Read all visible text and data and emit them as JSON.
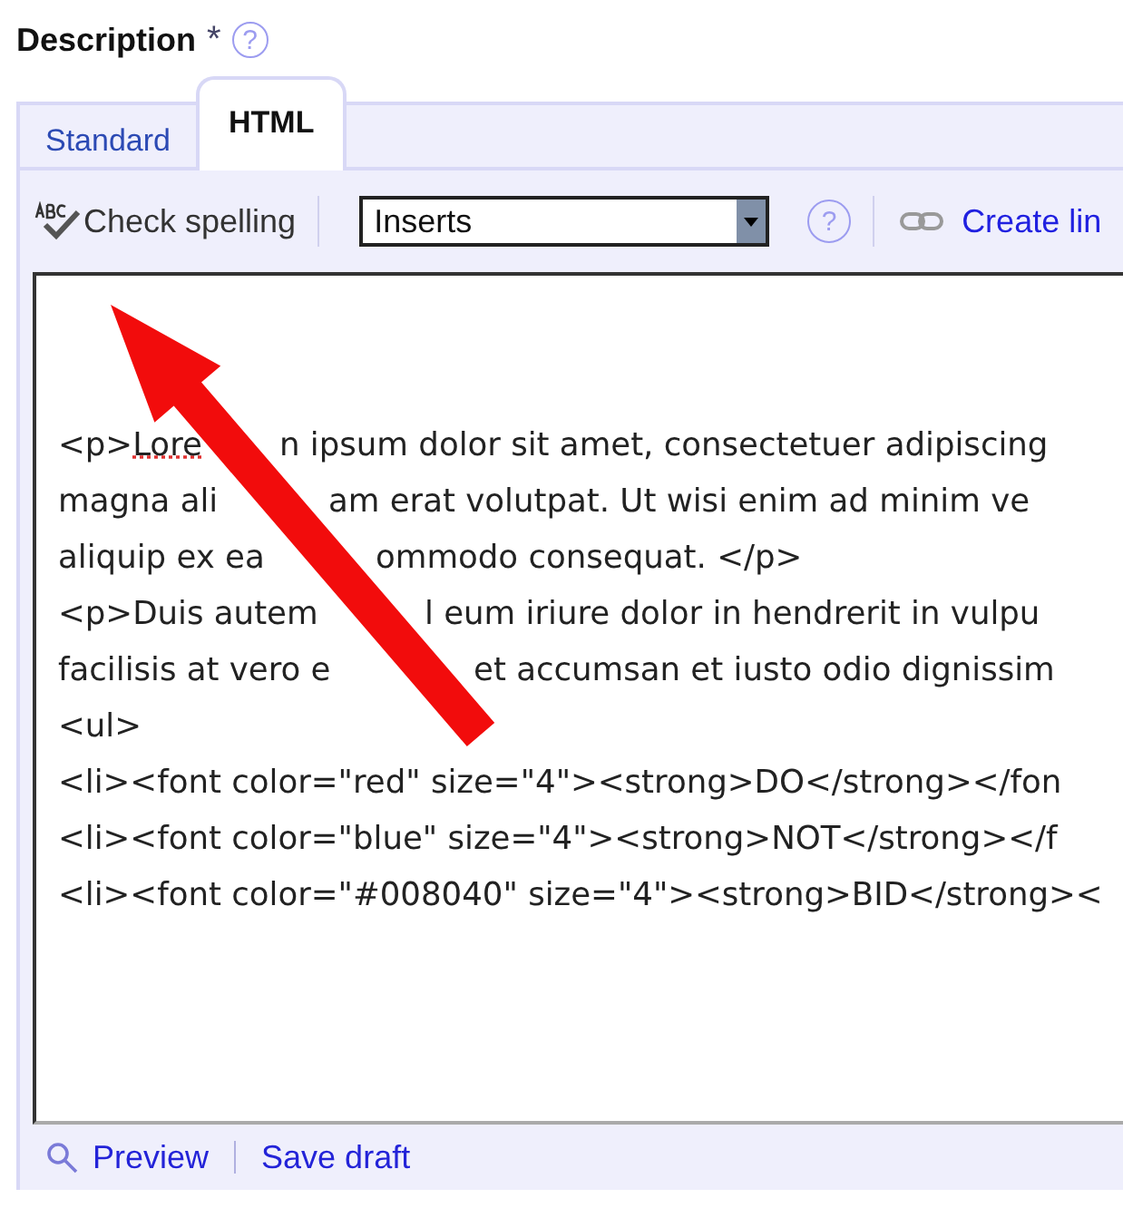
{
  "field": {
    "label": "Description",
    "required_mark": "*",
    "help": "?"
  },
  "tabs": [
    {
      "label": "Standard",
      "selected": false
    },
    {
      "label": "HTML",
      "selected": true
    }
  ],
  "toolbar": {
    "spellcheck": "Check spelling",
    "inserts": {
      "value": "Inserts"
    },
    "help": "?",
    "create_link": "Create lin"
  },
  "editor": {
    "lines": [
      {
        "before": [
          {
            "text": "<p>",
            "misspelled": false
          },
          {
            "text": "Lore",
            "misspelled": true
          }
        ],
        "after": "n ipsum dolor sit amet, consectetuer adipiscing"
      },
      {
        "before": [
          {
            "text": "magna ali",
            "misspelled": false
          }
        ],
        "after": "am erat volutpat. Ut wisi enim ad minim ve"
      },
      {
        "before": [
          {
            "text": "aliquip ex ea",
            "misspelled": false
          }
        ],
        "after": "ommodo consequat. </p>"
      },
      {
        "before": [
          {
            "text": "<p>Duis autem",
            "misspelled": false
          }
        ],
        "after": "l eum iriure dolor in hendrerit in vulpu"
      },
      {
        "before": [
          {
            "text": "facilisis at vero e",
            "misspelled": false
          }
        ],
        "after": "et accumsan et iusto odio dignissim"
      },
      {
        "before": [
          {
            "text": "<ul>",
            "misspelled": false
          }
        ]
      },
      {
        "before": [
          {
            "text": "<li><font color=\"red\" size=\"4\"><strong>DO</strong></fon",
            "misspelled": false
          }
        ]
      },
      {
        "before": [
          {
            "text": "<li><font color=\"blue\" size=\"4\"><strong>NOT</strong></f",
            "misspelled": false
          }
        ]
      },
      {
        "before": [
          {
            "text": "<li><font color=\"#008040\" size=\"4\"><strong>BID</strong><",
            "misspelled": false
          }
        ]
      }
    ],
    "overlay": {
      "kind": "arrow"
    }
  },
  "footer": {
    "links": [
      "Preview",
      "Save draft"
    ]
  }
}
